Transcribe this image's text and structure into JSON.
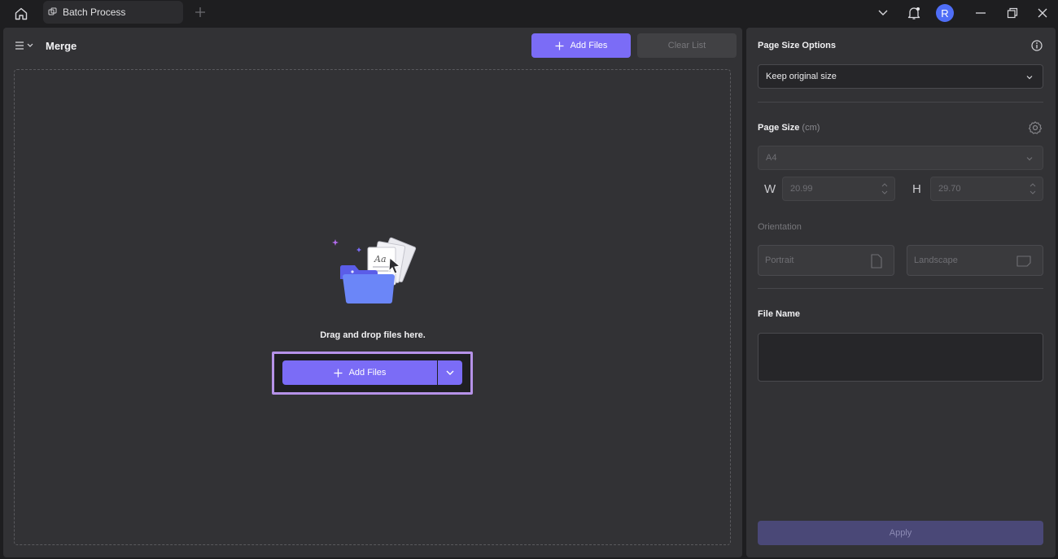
{
  "titlebar": {
    "tab_label": "Batch Process",
    "avatar_initial": "R"
  },
  "left": {
    "mode_title": "Merge",
    "add_files_label": "Add Files",
    "clear_list_label": "Clear List",
    "drop_text": "Drag and drop files here.",
    "main_add_files_label": "Add Files"
  },
  "right": {
    "page_size_options_label": "Page Size Options",
    "page_size_options_value": "Keep original size",
    "page_size_label": "Page Size",
    "page_size_unit": "(cm)",
    "paper_value": "A4",
    "width_letter": "W",
    "width_value": "20.99",
    "height_letter": "H",
    "height_value": "29.70",
    "orientation_label": "Orientation",
    "portrait_label": "Portrait",
    "landscape_label": "Landscape",
    "file_name_label": "File Name",
    "file_name_value": "",
    "apply_label": "Apply"
  },
  "colors": {
    "accent": "#7b6cf6",
    "highlight": "#b692e8",
    "panel": "#323235",
    "background": "#1e1e20"
  }
}
